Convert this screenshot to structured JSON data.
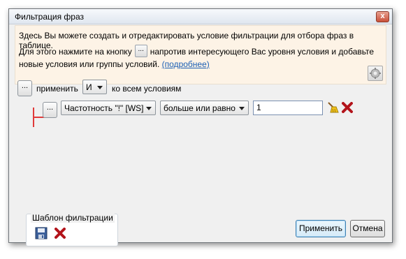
{
  "window": {
    "title": "Фильтрация фраз",
    "close_glyph": "x"
  },
  "info": {
    "line1": "Здесь Вы можете создать и отредактировать условие фильтрации для отбора фраз в таблице.",
    "line2_before": "Для этого нажмите на кнопку",
    "line2_button": "...",
    "line2_after": "напротив интересующего Вас уровня условия и добавьте",
    "line3": "новые условия или группы условий.",
    "more_link": "(подробнее)",
    "settings_icon": "gear-icon"
  },
  "root_condition": {
    "menu_button": "...",
    "apply_label": "применить",
    "operator": "И",
    "suffix_label": "ко всем условиям"
  },
  "condition": {
    "menu_button": "...",
    "field": "Частотность \"!\" [WS]",
    "comparison": "больше или равно",
    "value": "1",
    "clear_icon": "broom-icon",
    "delete_icon": "red-x-icon"
  },
  "template": {
    "title": "Шаблон фильтрации",
    "save_icon": "save-icon",
    "delete_icon": "red-x-icon"
  },
  "buttons": {
    "apply": "Применить",
    "cancel": "Отмена"
  },
  "colors": {
    "tree_line": "#e03a3a",
    "delete_red": "#b3141b",
    "link": "#1a5fb4"
  }
}
